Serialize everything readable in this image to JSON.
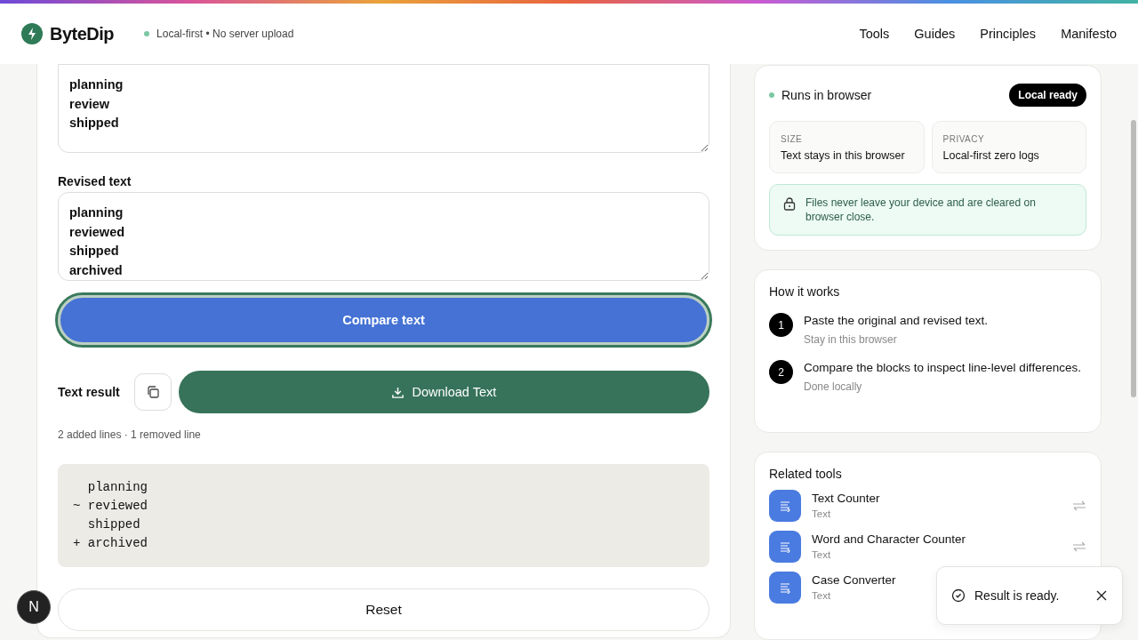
{
  "header": {
    "brand": "ByteDip",
    "tagline": "Local-first • No server upload",
    "nav": [
      "Tools",
      "Guides",
      "Principles",
      "Manifesto"
    ]
  },
  "editor": {
    "original_text": "planning\nreview\nshipped",
    "revised_label": "Revised text",
    "revised_text": "planning\nreviewed\nshipped\narchived",
    "compare_button": "Compare text",
    "result_label": "Text result",
    "download_button": "Download Text",
    "stats": "2 added lines · 1 removed line",
    "diff_lines": [
      "  planning",
      "~ reviewed",
      "  shipped",
      "+ archived"
    ],
    "reset_button": "Reset"
  },
  "status_card": {
    "status": "Runs in browser",
    "badge": "Local ready",
    "facts": [
      {
        "label": "SIZE",
        "value": "Text stays in this browser"
      },
      {
        "label": "PRIVACY",
        "value": "Local-first zero logs"
      }
    ],
    "notice": "Files never leave your device and are cleared on browser close."
  },
  "how_it_works": {
    "title": "How it works",
    "steps": [
      {
        "number": "1",
        "text": "Paste the original and revised text.",
        "note": "Stay in this browser"
      },
      {
        "number": "2",
        "text": "Compare the blocks to inspect line-level differences.",
        "note": "Done locally"
      }
    ]
  },
  "related_tools": {
    "title": "Related tools",
    "items": [
      {
        "name": "Text Counter",
        "category": "Text"
      },
      {
        "name": "Word and Character Counter",
        "category": "Text"
      },
      {
        "name": "Case Converter",
        "category": "Text"
      }
    ]
  },
  "toast": {
    "message": "Result is ready."
  },
  "dev_badge": {
    "label": "N"
  }
}
